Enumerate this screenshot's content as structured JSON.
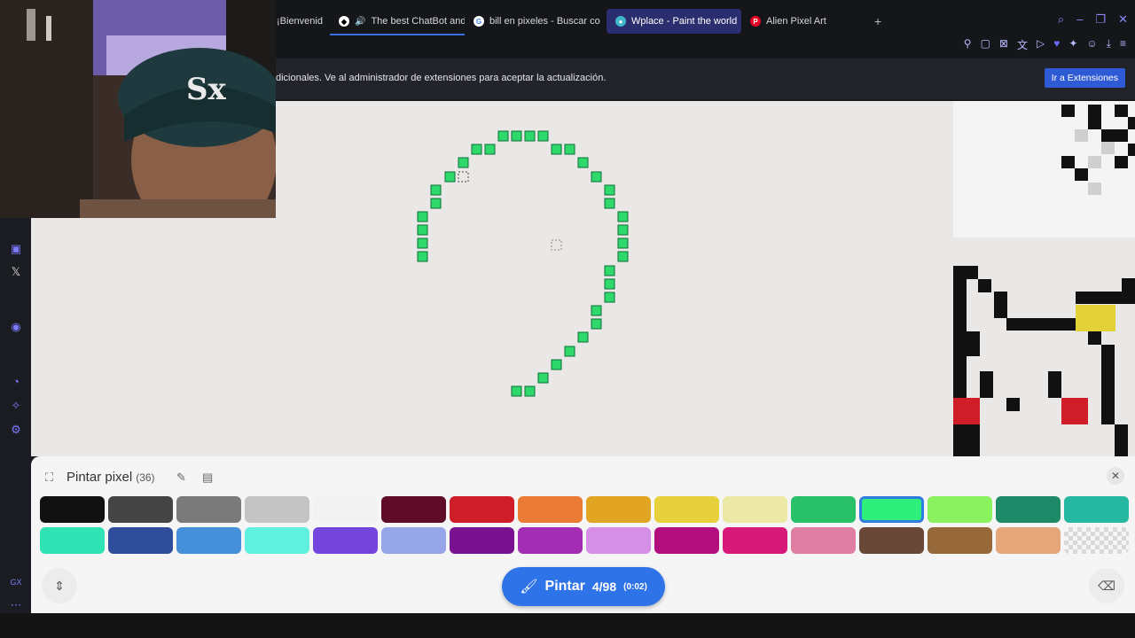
{
  "browser": {
    "tabs": [
      {
        "label": "¡Bienvenid",
        "icon": "tab-favicon",
        "color": "#444"
      },
      {
        "label": "The best ChatBot and",
        "icon": "chatbot-favicon",
        "color": "#ffffff"
      },
      {
        "label": "bill en pixeles - Buscar co",
        "icon": "google-favicon",
        "color": "#4285f4"
      },
      {
        "label": "Wplace - Paint the world",
        "icon": "wplace-favicon",
        "color": "#3fb5c9"
      },
      {
        "label": "Alien Pixel Art",
        "icon": "pinterest-favicon",
        "color": "#e60023"
      }
    ],
    "new_tab": "+"
  },
  "notification": {
    "text": "dicionales. Ve al administrador de extensiones para aceptar la actualización.",
    "button": "Ir a Extensiones"
  },
  "panel": {
    "title": "Pintar pixel",
    "count": "(36)",
    "close": "✕"
  },
  "palette": [
    [
      "#111111",
      "#444444",
      "#7a7a7a",
      "#c4c4c4",
      "#f2f2f2",
      "#5e0c28",
      "#d01d2a",
      "#e97b34",
      "#e2a423",
      "#e6d03c",
      "#ece9a6",
      "#29c06a",
      "#2fef7c",
      "#8bf25f",
      "#1f8a67",
      "#27b8a1"
    ],
    [
      "#2fe3b5",
      "#2f4d9a",
      "#4690d9",
      "#5ff0e0",
      "#7345dd",
      "#97a6e8",
      "#7a1191",
      "#a32db3",
      "#d58fe6",
      "#b30e7e",
      "#d8197a",
      "#df7ea3",
      "#6a4837",
      "#96683a",
      "#e5a77a",
      "checker"
    ]
  ],
  "selected_color": "#2fef7c",
  "paint_button": {
    "label": "Pintar",
    "count": "4/98",
    "timer": "(0:02)"
  },
  "colors": {
    "accent": "#2e73e8",
    "placed_pixel": "#2fd86a",
    "canvas": "#e9e8e6"
  }
}
